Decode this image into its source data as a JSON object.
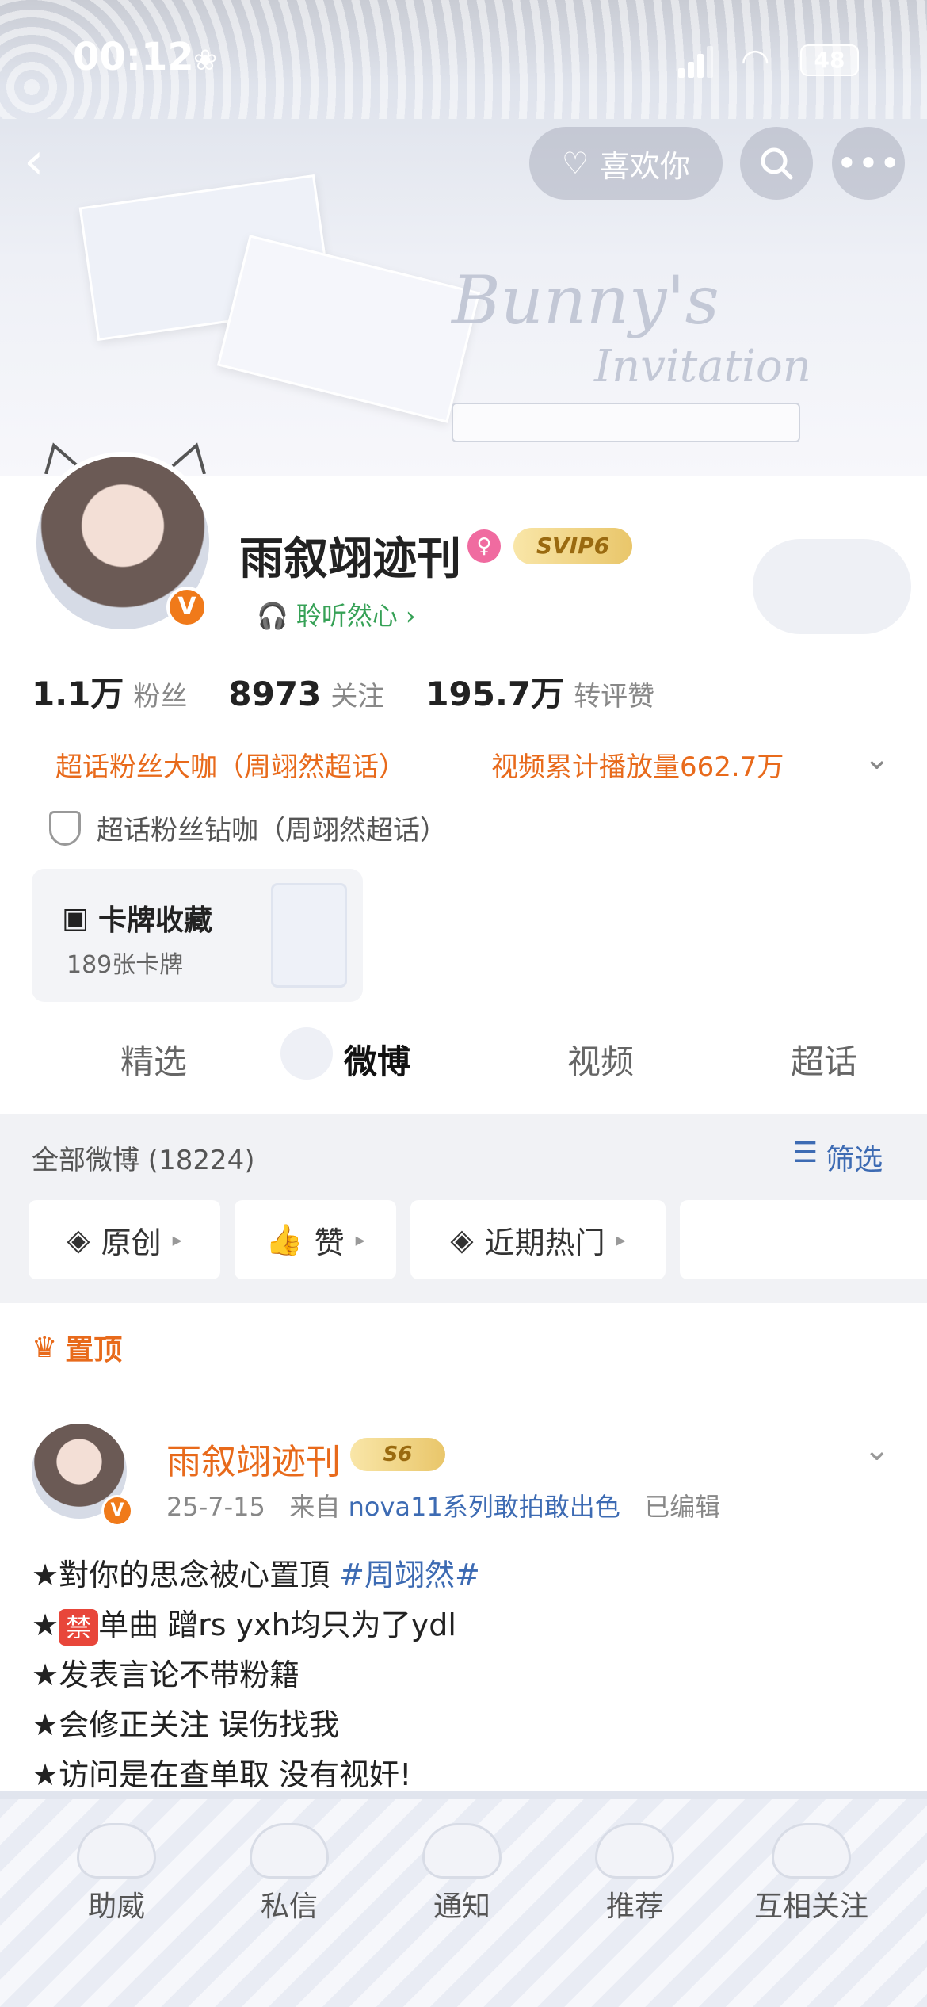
{
  "status_bar": {
    "time": "00:12",
    "battery": "48"
  },
  "header": {
    "like_label": "喜欢你",
    "banner_title": "Bunny's",
    "banner_subtitle": "Invitation"
  },
  "profile": {
    "name": "雨叙翊迹刊",
    "vip_badge": "SVIP6",
    "verified": "V",
    "listen_label": "聆听然心",
    "stats": [
      {
        "value": "1.1万",
        "label": "粉丝"
      },
      {
        "value": "8973",
        "label": "关注"
      },
      {
        "value": "195.7万",
        "label": "转评赞"
      }
    ],
    "badges": [
      "超话粉丝大咖（周翊然超话）",
      "视频累计播放量662.7万"
    ],
    "honor": "超话粉丝钻咖（周翊然超话）",
    "card_collection": {
      "title": "卡牌收藏",
      "count": "189张卡牌"
    }
  },
  "tabs": [
    "精选",
    "微博",
    "视频",
    "超话"
  ],
  "feed_filter": {
    "all_label": "全部微博 (18224)",
    "filter_label": "筛选",
    "chips": [
      "原创",
      "赞",
      "近期热门"
    ]
  },
  "post": {
    "pinned_label": "置顶",
    "author": "雨叙翊迹刊",
    "level_badge": "S6",
    "date": "25-7-15",
    "from_prefix": "来自",
    "source": "nova11系列敢拍敢出色",
    "edited": "已编辑",
    "line1_text": "★對你的思念被心置頂 ",
    "line1_tag": "#周翊然#",
    "line2_ban": "禁",
    "line2_text": "单曲 蹭rs yxh均只为了ydl",
    "line3": "★发表言论不带粉籍",
    "line4": "★会修正关注 误伤找我",
    "line5": "★访问是在查单取 没有视奸!"
  },
  "bottom_nav": [
    "助威",
    "私信",
    "通知",
    "推荐",
    "互相关注"
  ],
  "colors": {
    "accent_orange": "#e86a1b",
    "link_blue": "#3d6bb3",
    "green": "#36a156"
  }
}
